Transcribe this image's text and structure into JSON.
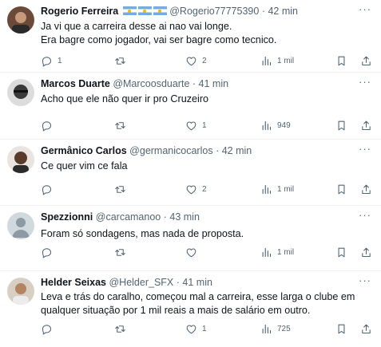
{
  "replies": [
    {
      "name": "Rogerio Ferreira",
      "handle": "@Rogerio77775390",
      "dot": "·",
      "time": "42 min",
      "text": "Ja vi que a carreira desse ai nao vai longe.\nEra bagre como jogador, vai ser bagre como tecnico.",
      "reply_count": "1",
      "retweet_count": "",
      "like_count": "2",
      "views": "1 mil",
      "flags": "🇦🇷 🇦🇷"
    },
    {
      "name": "Marcos Duarte",
      "handle": "@Marcoosduarte",
      "dot": "·",
      "time": "41 min",
      "text": "Acho que ele não quer ir pro Cruzeiro",
      "reply_count": "",
      "retweet_count": "",
      "like_count": "1",
      "views": "949"
    },
    {
      "name": "Germânico Carlos",
      "handle": "@germanicocarlos",
      "dot": "·",
      "time": "42 min",
      "text": "Ce quer vim ce fala",
      "reply_count": "",
      "retweet_count": "",
      "like_count": "2",
      "views": "1 mil"
    },
    {
      "name": "Spezzionni",
      "handle": "@carcamanoo",
      "dot": "·",
      "time": "43 min",
      "text": "Foram só sondagens, mas nada de proposta.",
      "reply_count": "",
      "retweet_count": "",
      "like_count": "",
      "views": "1 mil"
    },
    {
      "name": "Helder Seixas",
      "handle": "@Helder_SFX",
      "dot": "·",
      "time": "41 min",
      "text": "Leva e trás do caralho, começou mal a carreira, esse larga o clube em\nqualquer situação por 1 mil reais a mais de salário em outro.",
      "reply_count": "",
      "retweet_count": "",
      "like_count": "1",
      "views": "725"
    }
  ],
  "more_label": "···",
  "colors": {
    "text": "#0f1419",
    "secondary": "#536471",
    "divider": "#eff3f4"
  },
  "icons": [
    "reply-icon",
    "retweet-icon",
    "like-icon",
    "views-icon",
    "bookmark-icon",
    "share-icon",
    "more-icon"
  ]
}
